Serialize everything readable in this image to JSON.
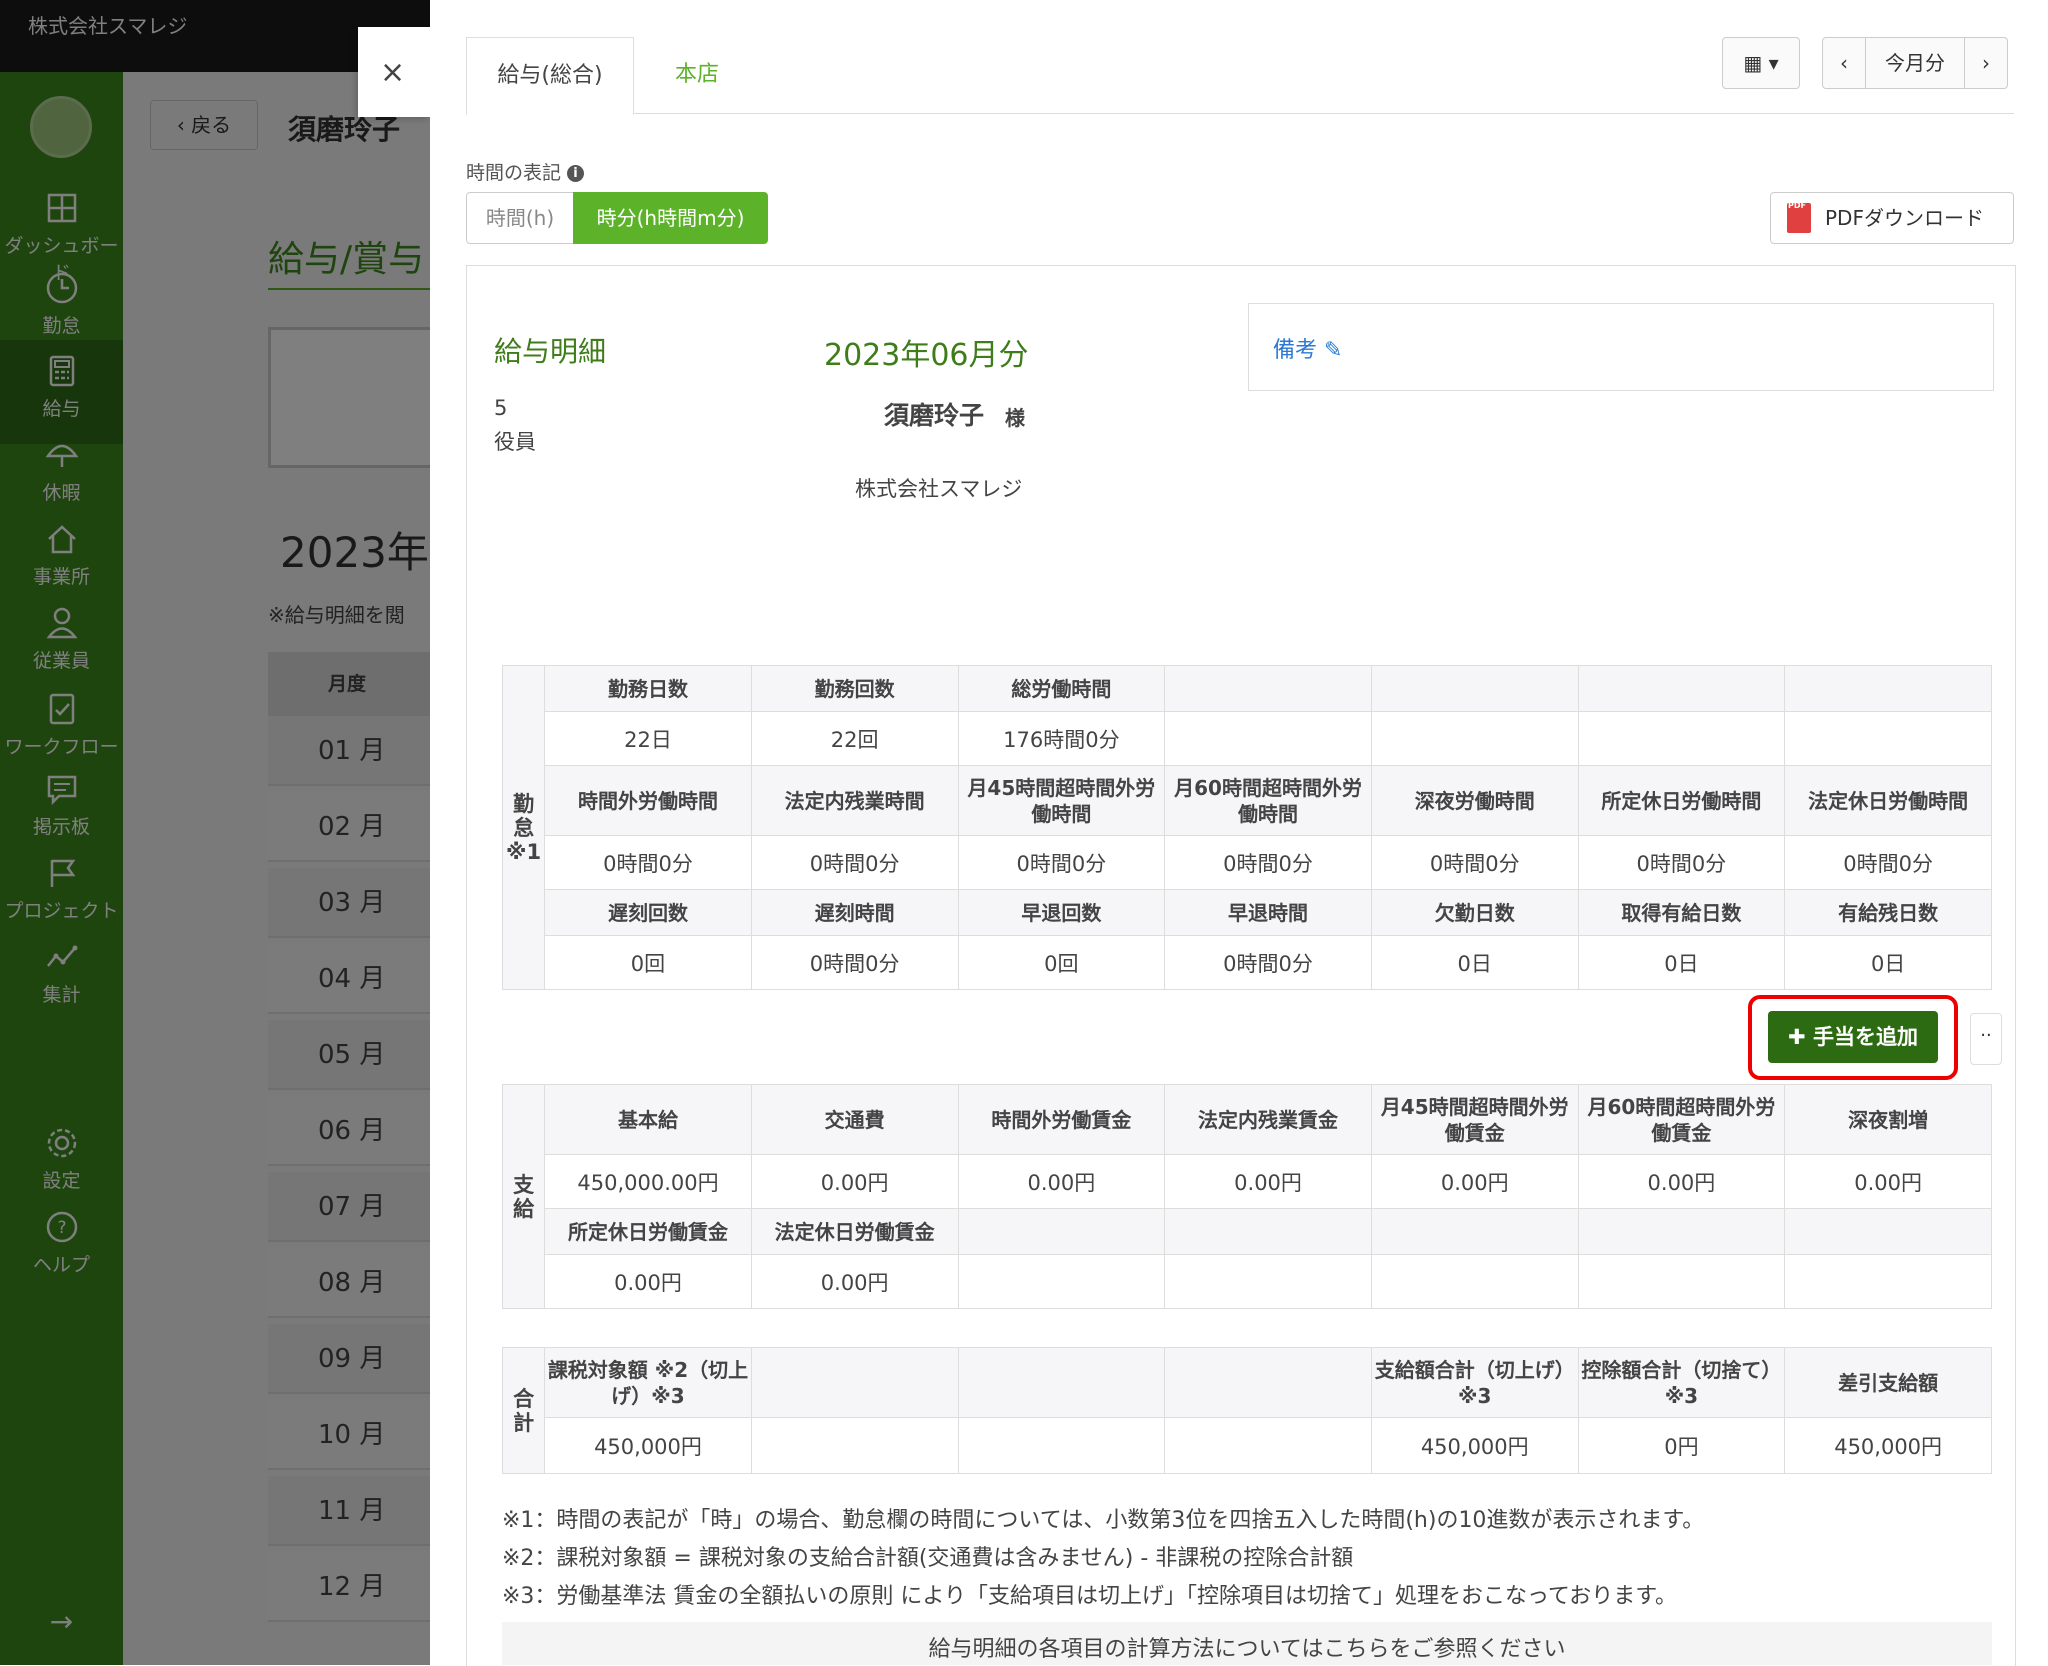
{
  "app": {
    "company": "株式会社スマレジ"
  },
  "sidebar": {
    "items": [
      {
        "label": "ダッシュボード",
        "icon": "dashboard-icon"
      },
      {
        "label": "勤怠",
        "icon": "clock-icon"
      },
      {
        "label": "給与",
        "icon": "calculator-icon"
      },
      {
        "label": "休暇",
        "icon": "umbrella-icon"
      },
      {
        "label": "事業所",
        "icon": "home-icon"
      },
      {
        "label": "従業員",
        "icon": "user-icon"
      },
      {
        "label": "ワークフロー",
        "icon": "workflow-icon"
      },
      {
        "label": "掲示板",
        "icon": "message-icon"
      },
      {
        "label": "プロジェクト",
        "icon": "flag-icon"
      },
      {
        "label": "集計",
        "icon": "chart-icon"
      },
      {
        "label": "設定",
        "icon": "gear-icon"
      },
      {
        "label": "ヘルプ",
        "icon": "help-icon"
      }
    ]
  },
  "background": {
    "back_label": "戻る",
    "employee": "須磨玲子",
    "section_title": "給与/賞与",
    "year": "2023年",
    "note": "※給与明細を閲",
    "month_header": "月度",
    "months": [
      "01 月",
      "02 月",
      "03 月",
      "04 月",
      "05 月",
      "06 月",
      "07 月",
      "08 月",
      "09 月",
      "10 月",
      "11 月",
      "12 月"
    ]
  },
  "modal": {
    "close": "×",
    "tabs": [
      "給与(総合)",
      "本店"
    ],
    "current_month_label": "今月分",
    "time_notation_label": "時間の表記",
    "time_options": [
      "時間(h)",
      "時分(h時間m分)"
    ],
    "pdf_label": "PDFダウンロード",
    "slip": {
      "title": "給与明細",
      "month": "2023年06月分",
      "employee_no": "5",
      "role": "役員",
      "name": "須磨玲子",
      "honorific": "様",
      "company": "株式会社スマレジ",
      "remarks_label": "備考"
    },
    "attendance": {
      "side_label": "勤怠※1",
      "rows": [
        {
          "headers": [
            "勤務日数",
            "勤務回数",
            "総労働時間",
            "",
            "",
            "",
            ""
          ],
          "values": [
            "22日",
            "22回",
            "176時間0分",
            "",
            "",
            "",
            ""
          ]
        },
        {
          "headers": [
            "時間外労働時間",
            "法定内残業時間",
            "月45時間超時間外労働時間",
            "月60時間超時間外労働時間",
            "深夜労働時間",
            "所定休日労働時間",
            "法定休日労働時間"
          ],
          "values": [
            "0時間0分",
            "0時間0分",
            "0時間0分",
            "0時間0分",
            "0時間0分",
            "0時間0分",
            "0時間0分"
          ]
        },
        {
          "headers": [
            "遅刻回数",
            "遅刻時間",
            "早退回数",
            "早退時間",
            "欠勤日数",
            "取得有給日数",
            "有給残日数"
          ],
          "values": [
            "0回",
            "0時間0分",
            "0回",
            "0時間0分",
            "0日",
            "0日",
            "0日"
          ]
        }
      ]
    },
    "add_allowance_label": "手当を追加",
    "more_label": "··",
    "payments": {
      "side_label": "支給",
      "rows": [
        {
          "headers": [
            "基本給",
            "交通費",
            "時間外労働賃金",
            "法定内残業賃金",
            "月45時間超時間外労働賃金",
            "月60時間超時間外労働賃金",
            "深夜割増"
          ],
          "values": [
            "450,000.00円",
            "0.00円",
            "0.00円",
            "0.00円",
            "0.00円",
            "0.00円",
            "0.00円"
          ]
        },
        {
          "headers": [
            "所定休日労働賃金",
            "法定休日労働賃金",
            "",
            "",
            "",
            "",
            ""
          ],
          "values": [
            "0.00円",
            "0.00円",
            "",
            "",
            "",
            "",
            ""
          ]
        }
      ]
    },
    "totals": {
      "side_label": "合計",
      "headers": [
        "課税対象額 ※2（切上げ）※3",
        "",
        "",
        "",
        "支給額合計（切上げ）※3",
        "控除額合計（切捨て）※3",
        "差引支給額"
      ],
      "values": [
        "450,000円",
        "",
        "",
        "",
        "450,000円",
        "0円",
        "450,000円"
      ]
    },
    "notes": [
      "※1：時間の表記が「時」の場合、勤怠欄の時間については、小数第3位を四捨五入した時間(h)の10進数が表示されます。",
      "※2：課税対象額 = 課税対象の支給合計額(交通費は含みません) - 非課税の控除合計額",
      "※3：労働基準法 賃金の全額払いの原則 により「支給項目は切上げ」「控除項目は切捨て」処理をおこなっております。"
    ],
    "calc_link": "給与明細の各項目の計算方法についてはこちらをご参照ください"
  }
}
